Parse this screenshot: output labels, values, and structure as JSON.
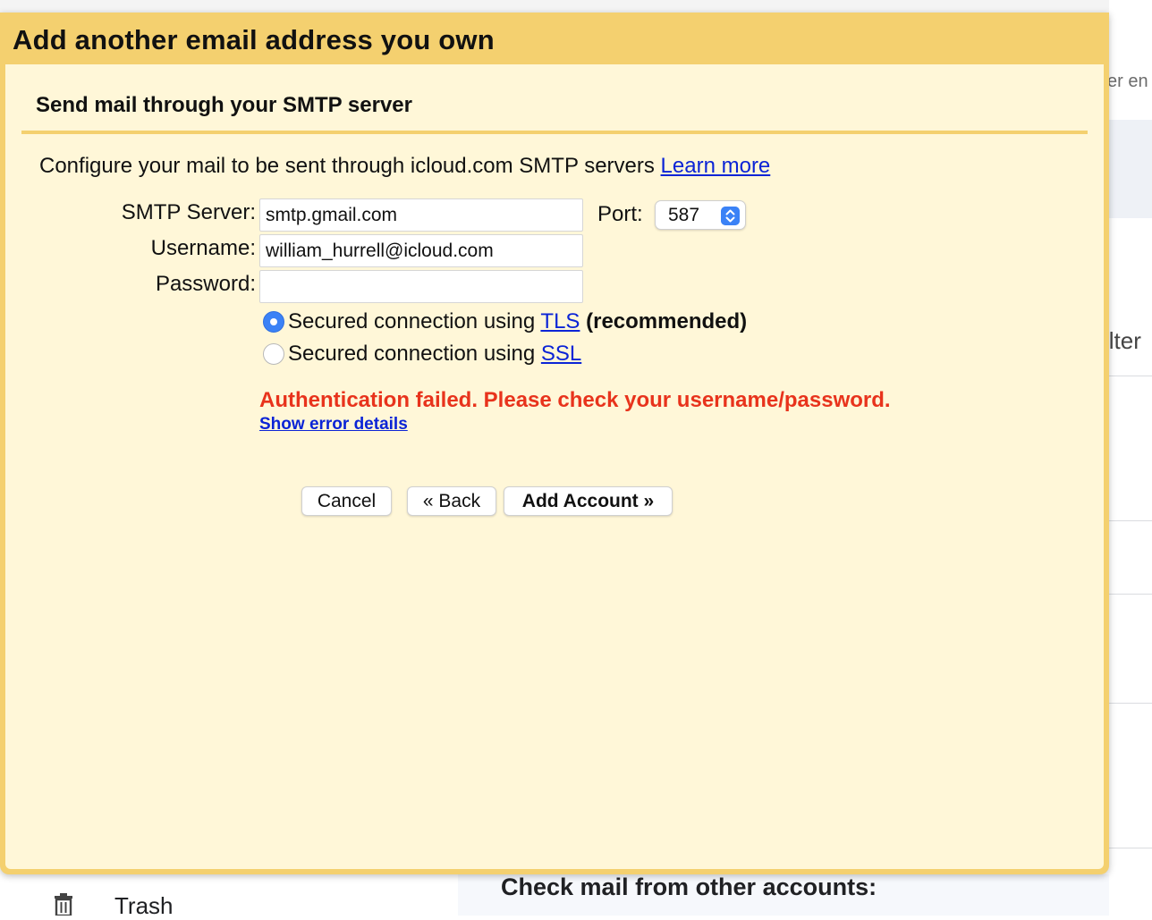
{
  "dialog": {
    "title": "Add another email address you own",
    "section_title": "Send mail through your SMTP server",
    "intro_text": "Configure your mail to be sent through icloud.com SMTP servers",
    "learn_more": "Learn more"
  },
  "form": {
    "smtp_server_label": "SMTP Server:",
    "smtp_server_value": "smtp.gmail.com",
    "port_label": "Port:",
    "port_value": "587",
    "username_label": "Username:",
    "username_value": "william_hurrell@icloud.com",
    "password_label": "Password:",
    "password_value": "",
    "tls_option": {
      "prefix": "Secured connection using",
      "link": "TLS",
      "suffix": "(recommended)",
      "selected": true
    },
    "ssl_option": {
      "prefix": "Secured connection using",
      "link": "SSL",
      "selected": false
    },
    "error_message": "Authentication failed. Please check your username/password.",
    "error_details_link": "Show error details"
  },
  "buttons": {
    "cancel": "Cancel",
    "back": "« Back",
    "add_account": "Add Account »"
  },
  "background": {
    "right_text_top": "er en",
    "right_text_mid": "ilter",
    "trash_label": "Trash",
    "check_mail_heading": "Check mail from other accounts:"
  },
  "colors": {
    "dialog_header": "#f4d06f",
    "dialog_body": "#fff7d8",
    "error": "#e8331c",
    "link": "#0b24d6",
    "radio_selected": "#3b82f6"
  }
}
